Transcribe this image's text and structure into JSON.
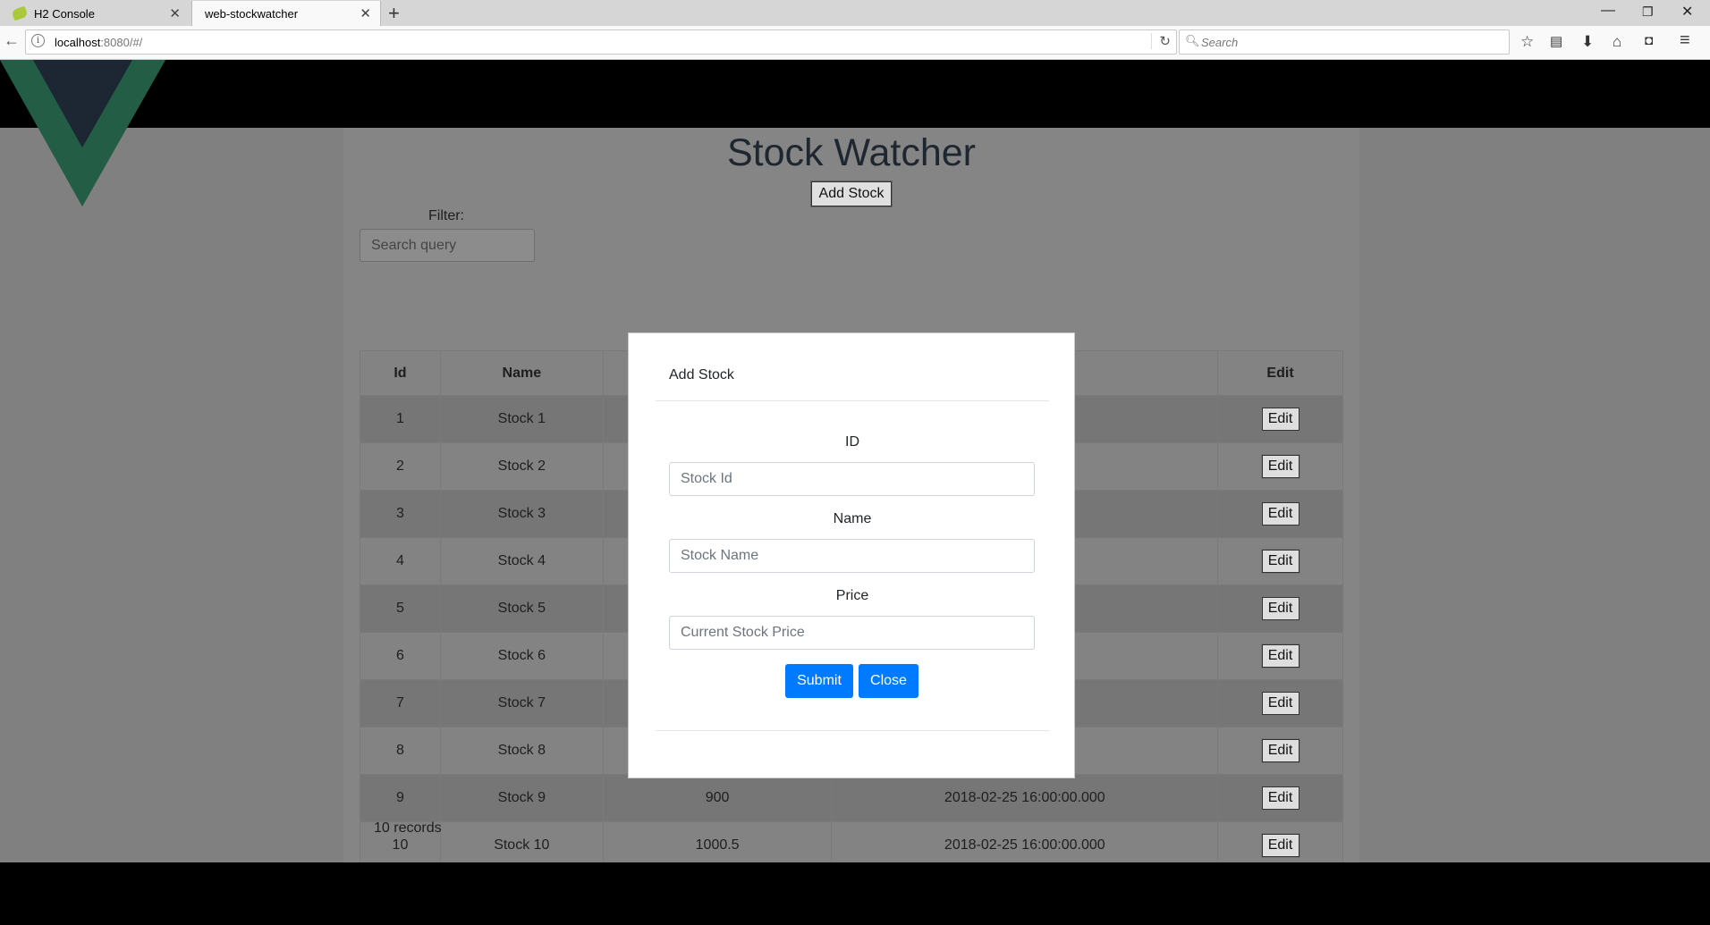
{
  "browser": {
    "tabs": [
      {
        "label": "H2 Console",
        "active": false
      },
      {
        "label": "web-stockwatcher",
        "active": true
      }
    ],
    "url_host": "localhost",
    "url_rest": ":8080/#/",
    "search_placeholder": "Search"
  },
  "app": {
    "title": "Stock Watcher",
    "add_stock_label": "Add Stock",
    "filter_label": "Filter:",
    "filter_placeholder": "Search query",
    "table": {
      "headers": [
        "Id",
        "Name",
        "",
        "",
        "Edit"
      ],
      "rows": [
        {
          "id": "1",
          "name": "Stock 1",
          "price": "",
          "time": ".000",
          "edit": "Edit"
        },
        {
          "id": "2",
          "name": "Stock 2",
          "price": "",
          "time": ".000",
          "edit": "Edit"
        },
        {
          "id": "3",
          "name": "Stock 3",
          "price": "",
          "time": ".000",
          "edit": "Edit"
        },
        {
          "id": "4",
          "name": "Stock 4",
          "price": "",
          "time": ".000",
          "edit": "Edit"
        },
        {
          "id": "5",
          "name": "Stock 5",
          "price": "",
          "time": ".000",
          "edit": "Edit"
        },
        {
          "id": "6",
          "name": "Stock 6",
          "price": "",
          "time": ".000",
          "edit": "Edit"
        },
        {
          "id": "7",
          "name": "Stock 7",
          "price": "",
          "time": ".000",
          "edit": "Edit"
        },
        {
          "id": "8",
          "name": "Stock 8",
          "price": "",
          "time": ".000",
          "edit": "Edit"
        },
        {
          "id": "9",
          "name": "Stock 9",
          "price": "900",
          "time": "2018-02-25 16:00:00.000",
          "edit": "Edit"
        },
        {
          "id": "10",
          "name": "Stock 10",
          "price": "1000.5",
          "time": "2018-02-25 16:00:00.000",
          "edit": "Edit"
        }
      ]
    },
    "records_text": "10 records"
  },
  "modal": {
    "title": "Add Stock",
    "id_label": "ID",
    "id_placeholder": "Stock Id",
    "name_label": "Name",
    "name_placeholder": "Stock Name",
    "price_label": "Price",
    "price_placeholder": "Current Stock Price",
    "submit_label": "Submit",
    "close_label": "Close"
  },
  "colors": {
    "primary_button": "#007bff",
    "vue_green": "#41b883",
    "vue_dark": "#35495e"
  }
}
